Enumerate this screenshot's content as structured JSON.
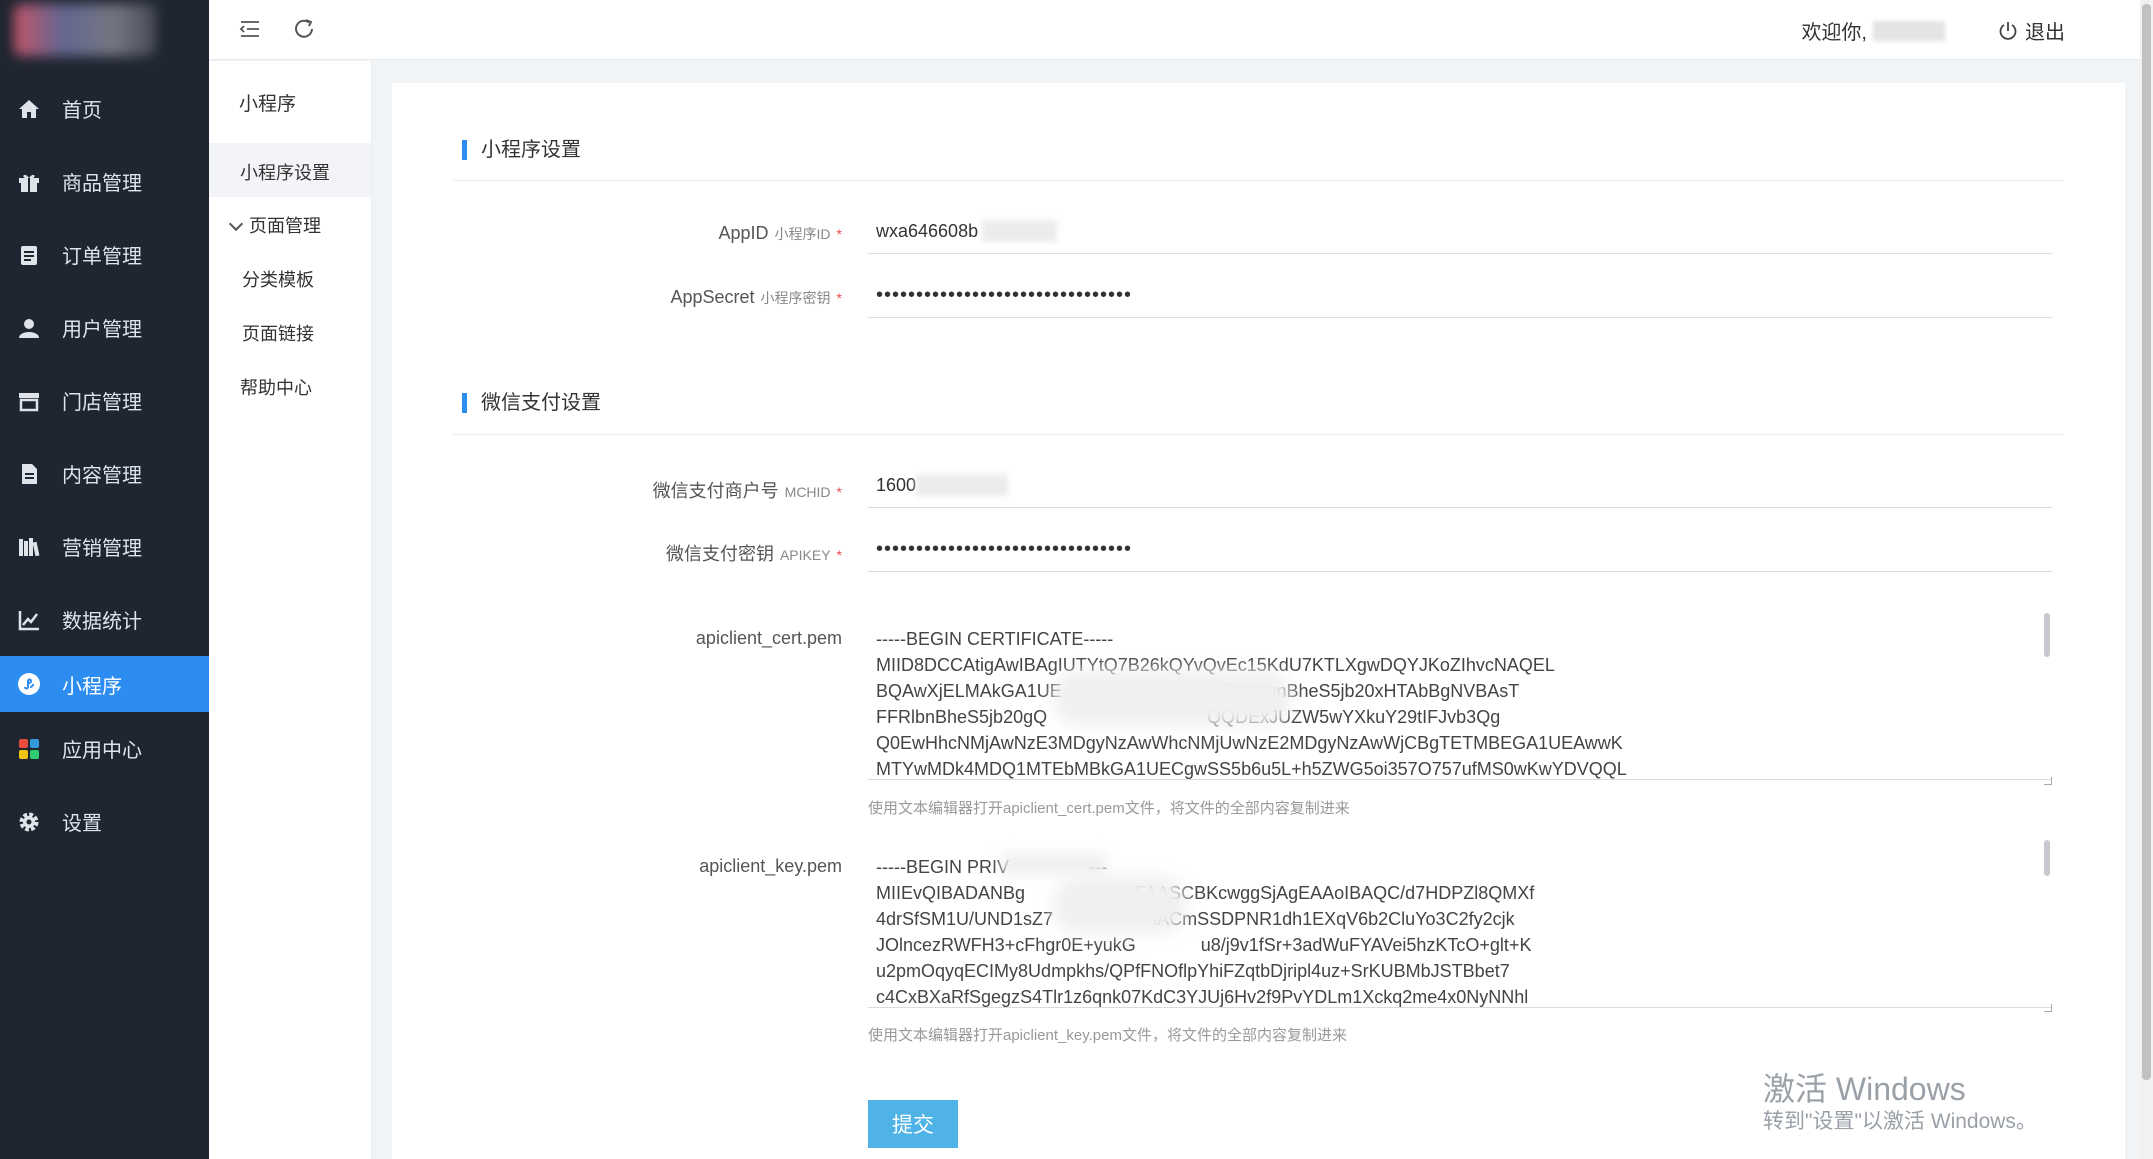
{
  "sidebar": {
    "items": [
      {
        "label": "首页",
        "icon": "home-icon"
      },
      {
        "label": "商品管理",
        "icon": "gift-icon"
      },
      {
        "label": "订单管理",
        "icon": "clipboard-icon"
      },
      {
        "label": "用户管理",
        "icon": "user-icon"
      },
      {
        "label": "门店管理",
        "icon": "store-icon"
      },
      {
        "label": "内容管理",
        "icon": "document-icon"
      },
      {
        "label": "营销管理",
        "icon": "books-icon"
      },
      {
        "label": "数据统计",
        "icon": "chart-icon"
      },
      {
        "label": "小程序",
        "icon": "miniprogram-icon",
        "active": true
      },
      {
        "label": "应用中心",
        "icon": "apps-icon"
      },
      {
        "label": "设置",
        "icon": "gear-icon"
      }
    ],
    "active_color": "#2d8cf0"
  },
  "header": {
    "welcome": "欢迎你,",
    "logout": "退出"
  },
  "submenu": {
    "title": "小程序",
    "items": {
      "settings": "小程序设置",
      "page_manage": "页面管理",
      "category_template": "分类模板",
      "page_link": "页面链接",
      "help_center": "帮助中心"
    }
  },
  "form": {
    "section1_title": "小程序设置",
    "appid_label": "AppID",
    "appid_en": "小程序ID",
    "appid_value": "wxa646608b",
    "appsecret_label": "AppSecret",
    "appsecret_en": "小程序密钥",
    "appsecret_value": "••••••••••••••••••••••••••••••••",
    "section2_title": "微信支付设置",
    "mchid_label": "微信支付商户号",
    "mchid_en": "MCHID",
    "mchid_value": "1600",
    "apikey_label": "微信支付密钥",
    "apikey_en": "APIKEY",
    "apikey_value": "••••••••••••••••••••••••••••••••",
    "cert_label": "apiclient_cert.pem",
    "cert_value": "-----BEGIN CERTIFICATE-----\nMIID8DCCAtigAwIBAgIUTYtQ7B26kQYvQvEc15KdU7KTLXgwDQYJKoZIhvcNAQEL\nBQAwXjELMAkGA1UE                                TClRlbnBheS5jb20xHTAbBgNVBAsT\nFFRlbnBheS5jb20gQ                                QQDExJUZW5wYXkuY29tIFJvb3Qg\nQ0EwHhcNMjAwNzE3MDgyNzAwWhcNMjUwNzE2MDgyNzAwWjCBgTETMBEGA1UEAwwK\nMTYwMDk4MDQ1MTEbMBkGA1UECgwSS5b6u5L+h5ZWG5oi357O757ufMS0wKwYDVQQL",
    "cert_hint": "使用文本编辑器打开apiclient_cert.pem文件，将文件的全部内容复制进来",
    "key_label": "apiclient_key.pem",
    "key_value": "-----BEGIN PRIV                ---\nMIIEvQIBADANBg                      FAASCBKcwggSjAgEAAoIBAQC/d7HDPZl8QMXf\n4drSfSM1U/UND1sZ7                    lACmSSDPNR1dh1EXqV6b2CluYo3C2fy2cjk\nJOlncezRWFH3+cFhgr0E+yukG             u8/j9v1fSr+3adWuFYAVei5hzKTcO+glt+K\nu2pmOqyqECIMy8Udmpkhs/QPfFNOflpYhiFZqtbDjripl4uz+SrKUBMbJSTBbet7\nc4CxBXaRfSgegzS4Tlr1z6qnk07KdC3YJUj6Hv2f9PvYDLm1Xckq2me4x0NyNNhl",
    "key_hint": "使用文本编辑器打开apiclient_key.pem文件，将文件的全部内容复制进来",
    "submit": "提交"
  },
  "watermark": {
    "line1": "激活 Windows",
    "line2": "转到\"设置\"以激活 Windows。"
  }
}
